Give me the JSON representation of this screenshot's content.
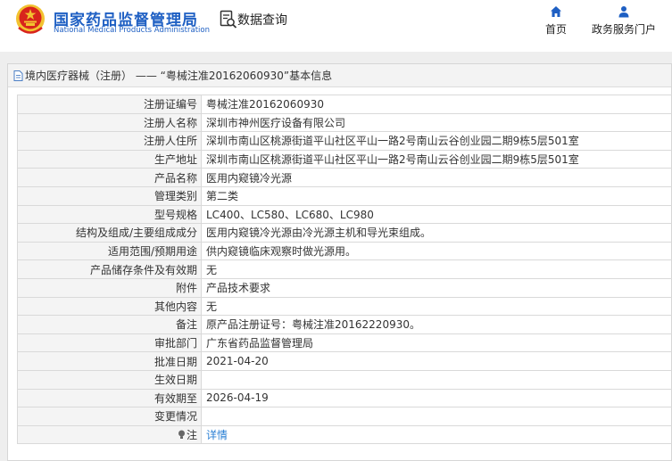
{
  "header": {
    "brand_cn": "国家药品监督管理局",
    "brand_en": "National Medical Products Administration",
    "query_label": "数据查询",
    "nav": [
      {
        "label": "首页",
        "icon": "home-icon"
      },
      {
        "label": "政务服务门户",
        "icon": "user-icon"
      }
    ]
  },
  "panel": {
    "title_prefix": "境内医疗器械（注册）",
    "title_sep": " —— ",
    "title_main": "“粤械注准20162060930”基本信息"
  },
  "rows": [
    {
      "label": "注册证编号",
      "value": "粤械注准20162060930"
    },
    {
      "label": "注册人名称",
      "value": "深圳市神州医疗设备有限公司"
    },
    {
      "label": "注册人住所",
      "value": "深圳市南山区桃源街道平山社区平山一路2号南山云谷创业园二期9栋5层501室"
    },
    {
      "label": "生产地址",
      "value": "深圳市南山区桃源街道平山社区平山一路2号南山云谷创业园二期9栋5层501室"
    },
    {
      "label": "产品名称",
      "value": "医用内窥镜冷光源"
    },
    {
      "label": "管理类别",
      "value": "第二类"
    },
    {
      "label": "型号规格",
      "value": "LC400、LC580、LC680、LC980"
    },
    {
      "label": "结构及组成/主要组成成分",
      "value": "医用内窥镜冷光源由冷光源主机和导光束组成。"
    },
    {
      "label": "适用范围/预期用途",
      "value": "供内窥镜临床观察时做光源用。"
    },
    {
      "label": "产品储存条件及有效期",
      "value": "无"
    },
    {
      "label": "附件",
      "value": "产品技术要求"
    },
    {
      "label": "其他内容",
      "value": "无"
    },
    {
      "label": "备注",
      "value": "原产品注册证号：粤械注准20162220930。"
    },
    {
      "label": "审批部门",
      "value": "广东省药品监督管理局"
    },
    {
      "label": "批准日期",
      "value": "2021-04-20"
    },
    {
      "label": "生效日期",
      "value": ""
    },
    {
      "label": "有效期至",
      "value": "2026-04-19"
    },
    {
      "label": "变更情况",
      "value": ""
    }
  ],
  "note_row": {
    "label": "注",
    "link": "详情"
  },
  "colors": {
    "brand": "#1e5fc3",
    "link": "#2a7fd4",
    "emblem_red": "#d8241c",
    "emblem_gold": "#f2c230"
  }
}
